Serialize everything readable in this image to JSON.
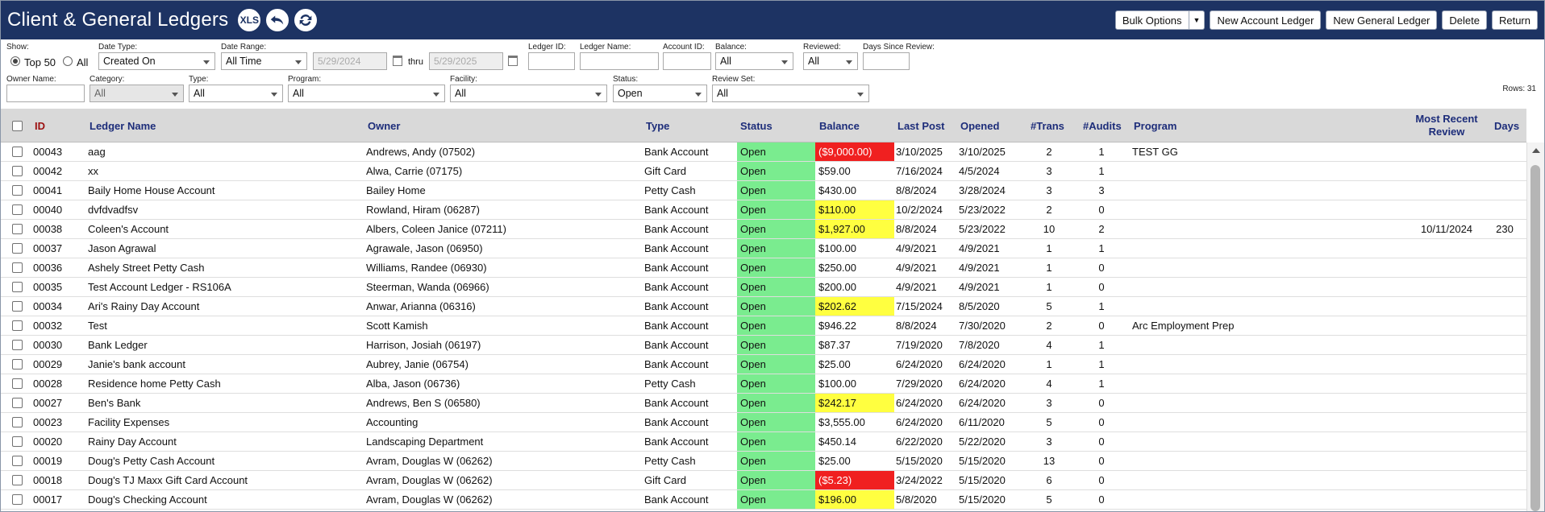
{
  "header": {
    "title": "Client & General Ledgers",
    "xls_label": "XLS",
    "buttons": {
      "bulk_options": "Bulk Options",
      "new_account_ledger": "New Account Ledger",
      "new_general_ledger": "New General Ledger",
      "delete": "Delete",
      "return": "Return"
    }
  },
  "filters": {
    "show_label": "Show:",
    "show_top50": "Top 50",
    "show_all": "All",
    "date_type_label": "Date Type:",
    "date_type_value": "Created On",
    "date_range_label": "Date Range:",
    "date_range_value": "All Time",
    "date_from": "5/29/2024",
    "thru_label": "thru",
    "date_to": "5/29/2025",
    "ledger_id_label": "Ledger ID:",
    "ledger_name_label": "Ledger Name:",
    "account_id_label": "Account ID:",
    "balance_label": "Balance:",
    "balance_value": "All",
    "reviewed_label": "Reviewed:",
    "reviewed_value": "All",
    "days_since_review_label": "Days Since Review:",
    "owner_name_label": "Owner Name:",
    "category_label": "Category:",
    "category_value": "All",
    "type_label": "Type:",
    "type_value": "All",
    "program_label": "Program:",
    "program_value": "All",
    "facility_label": "Facility:",
    "facility_value": "All",
    "status_label": "Status:",
    "status_value": "Open",
    "review_set_label": "Review Set:",
    "review_set_value": "All",
    "rows_count": "Rows: 31"
  },
  "table": {
    "columns": {
      "id": "ID",
      "ledger_name": "Ledger Name",
      "owner": "Owner",
      "type": "Type",
      "status": "Status",
      "balance": "Balance",
      "last_post": "Last Post",
      "opened": "Opened",
      "trans": "#Trans",
      "audits": "#Audits",
      "program": "Program",
      "most_recent_review": "Most Recent Review",
      "days": "Days"
    },
    "rows": [
      {
        "id": "00043",
        "name": "aag",
        "owner": "Andrews, Andy (07502)",
        "type": "Bank Account",
        "status": "Open",
        "balance": "($9,000.00)",
        "bal_flag": "red",
        "last_post": "3/10/2025",
        "opened": "3/10/2025",
        "trans": "2",
        "audits": "1",
        "program": "TEST GG",
        "review": "",
        "days": ""
      },
      {
        "id": "00042",
        "name": "xx",
        "owner": "Alwa, Carrie (07175)",
        "type": "Gift Card",
        "status": "Open",
        "balance": "$59.00",
        "bal_flag": "",
        "last_post": "7/16/2024",
        "opened": "4/5/2024",
        "trans": "3",
        "audits": "1",
        "program": "",
        "review": "",
        "days": ""
      },
      {
        "id": "00041",
        "name": "Baily Home House Account",
        "owner": "Bailey Home",
        "type": "Petty Cash",
        "status": "Open",
        "balance": "$430.00",
        "bal_flag": "",
        "last_post": "8/8/2024",
        "opened": "3/28/2024",
        "trans": "3",
        "audits": "3",
        "program": "",
        "review": "",
        "days": ""
      },
      {
        "id": "00040",
        "name": "dvfdvadfsv",
        "owner": "Rowland, Hiram (06287)",
        "type": "Bank Account",
        "status": "Open",
        "balance": "$110.00",
        "bal_flag": "yellow",
        "last_post": "10/2/2024",
        "opened": "5/23/2022",
        "trans": "2",
        "audits": "0",
        "program": "",
        "review": "",
        "days": ""
      },
      {
        "id": "00038",
        "name": "Coleen's Account",
        "owner": "Albers, Coleen Janice (07211)",
        "type": "Bank Account",
        "status": "Open",
        "balance": "$1,927.00",
        "bal_flag": "yellow",
        "last_post": "8/8/2024",
        "opened": "5/23/2022",
        "trans": "10",
        "audits": "2",
        "program": "",
        "review": "10/11/2024",
        "days": "230"
      },
      {
        "id": "00037",
        "name": "Jason Agrawal",
        "owner": "Agrawale, Jason (06950)",
        "type": "Bank Account",
        "status": "Open",
        "balance": "$100.00",
        "bal_flag": "",
        "last_post": "4/9/2021",
        "opened": "4/9/2021",
        "trans": "1",
        "audits": "1",
        "program": "",
        "review": "",
        "days": ""
      },
      {
        "id": "00036",
        "name": "Ashely Street Petty Cash",
        "owner": "Williams, Randee (06930)",
        "type": "Bank Account",
        "status": "Open",
        "balance": "$250.00",
        "bal_flag": "",
        "last_post": "4/9/2021",
        "opened": "4/9/2021",
        "trans": "1",
        "audits": "0",
        "program": "",
        "review": "",
        "days": ""
      },
      {
        "id": "00035",
        "name": "Test Account Ledger - RS106A",
        "owner": "Steerman, Wanda (06966)",
        "type": "Bank Account",
        "status": "Open",
        "balance": "$200.00",
        "bal_flag": "",
        "last_post": "4/9/2021",
        "opened": "4/9/2021",
        "trans": "1",
        "audits": "0",
        "program": "",
        "review": "",
        "days": ""
      },
      {
        "id": "00034",
        "name": "Ari's Rainy Day Account",
        "owner": "Anwar, Arianna (06316)",
        "type": "Bank Account",
        "status": "Open",
        "balance": "$202.62",
        "bal_flag": "yellow",
        "last_post": "7/15/2024",
        "opened": "8/5/2020",
        "trans": "5",
        "audits": "1",
        "program": "",
        "review": "",
        "days": ""
      },
      {
        "id": "00032",
        "name": "Test",
        "owner": "Scott Kamish",
        "type": "Bank Account",
        "status": "Open",
        "balance": "$946.22",
        "bal_flag": "",
        "last_post": "8/8/2024",
        "opened": "7/30/2020",
        "trans": "2",
        "audits": "0",
        "program": "Arc Employment Prep",
        "review": "",
        "days": ""
      },
      {
        "id": "00030",
        "name": "Bank Ledger",
        "owner": "Harrison, Josiah (06197)",
        "type": "Bank Account",
        "status": "Open",
        "balance": "$87.37",
        "bal_flag": "",
        "last_post": "7/19/2020",
        "opened": "7/8/2020",
        "trans": "4",
        "audits": "1",
        "program": "",
        "review": "",
        "days": ""
      },
      {
        "id": "00029",
        "name": "Janie's bank account",
        "owner": "Aubrey, Janie (06754)",
        "type": "Bank Account",
        "status": "Open",
        "balance": "$25.00",
        "bal_flag": "",
        "last_post": "6/24/2020",
        "opened": "6/24/2020",
        "trans": "1",
        "audits": "1",
        "program": "",
        "review": "",
        "days": ""
      },
      {
        "id": "00028",
        "name": "Residence home Petty Cash",
        "owner": "Alba, Jason (06736)",
        "type": "Petty Cash",
        "status": "Open",
        "balance": "$100.00",
        "bal_flag": "",
        "last_post": "7/29/2020",
        "opened": "6/24/2020",
        "trans": "4",
        "audits": "1",
        "program": "",
        "review": "",
        "days": ""
      },
      {
        "id": "00027",
        "name": "Ben's Bank",
        "owner": "Andrews, Ben S (06580)",
        "type": "Bank Account",
        "status": "Open",
        "balance": "$242.17",
        "bal_flag": "yellow",
        "last_post": "6/24/2020",
        "opened": "6/24/2020",
        "trans": "3",
        "audits": "0",
        "program": "",
        "review": "",
        "days": ""
      },
      {
        "id": "00023",
        "name": "Facility Expenses",
        "owner": "Accounting",
        "type": "Bank Account",
        "status": "Open",
        "balance": "$3,555.00",
        "bal_flag": "",
        "last_post": "6/24/2020",
        "opened": "6/11/2020",
        "trans": "5",
        "audits": "0",
        "program": "",
        "review": "",
        "days": ""
      },
      {
        "id": "00020",
        "name": "Rainy Day Account",
        "owner": "Landscaping Department",
        "type": "Bank Account",
        "status": "Open",
        "balance": "$450.14",
        "bal_flag": "",
        "last_post": "6/22/2020",
        "opened": "5/22/2020",
        "trans": "3",
        "audits": "0",
        "program": "",
        "review": "",
        "days": ""
      },
      {
        "id": "00019",
        "name": "Doug's Petty Cash Account",
        "owner": "Avram, Douglas W (06262)",
        "type": "Petty Cash",
        "status": "Open",
        "balance": "$25.00",
        "bal_flag": "",
        "last_post": "5/15/2020",
        "opened": "5/15/2020",
        "trans": "13",
        "audits": "0",
        "program": "",
        "review": "",
        "days": ""
      },
      {
        "id": "00018",
        "name": "Doug's TJ Maxx Gift Card Account",
        "owner": "Avram, Douglas W (06262)",
        "type": "Gift Card",
        "status": "Open",
        "balance": "($5.23)",
        "bal_flag": "red",
        "last_post": "3/24/2022",
        "opened": "5/15/2020",
        "trans": "6",
        "audits": "0",
        "program": "",
        "review": "",
        "days": ""
      },
      {
        "id": "00017",
        "name": "Doug's Checking Account",
        "owner": "Avram, Douglas W (06262)",
        "type": "Bank Account",
        "status": "Open",
        "balance": "$196.00",
        "bal_flag": "yellow",
        "last_post": "5/8/2020",
        "opened": "5/15/2020",
        "trans": "5",
        "audits": "0",
        "program": "",
        "review": "",
        "days": ""
      }
    ]
  }
}
